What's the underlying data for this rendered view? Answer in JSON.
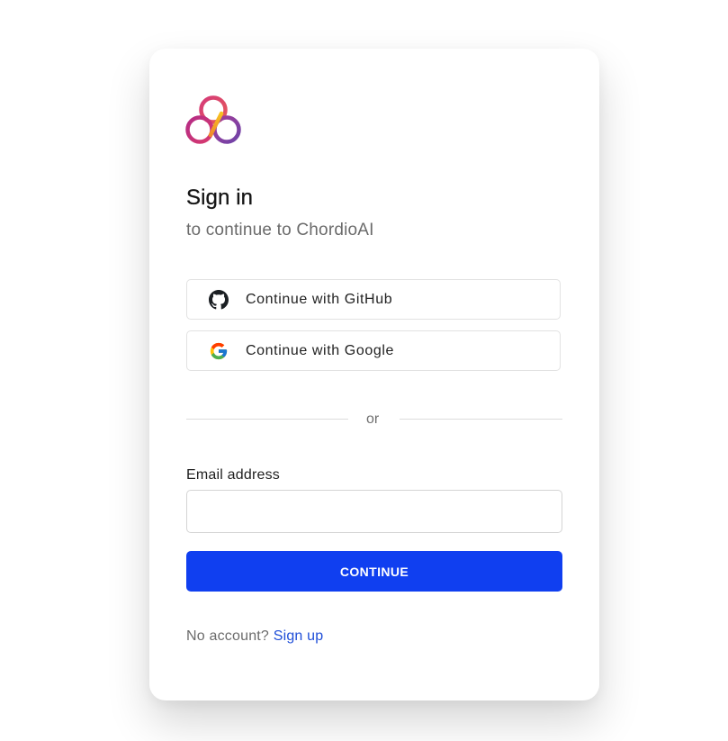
{
  "app": {
    "name": "ChordioAI"
  },
  "header": {
    "title": "Sign in",
    "subtitle": "to continue to ChordioAI"
  },
  "social": {
    "github_label": "Continue with GitHub",
    "google_label": "Continue with Google"
  },
  "divider": {
    "text": "or"
  },
  "email": {
    "label": "Email address",
    "value": "",
    "placeholder": ""
  },
  "continue_label": "CONTINUE",
  "footer": {
    "prompt": "No account?",
    "signup_link": "Sign up"
  },
  "colors": {
    "primary": "#103ff0",
    "link": "#1f4ed8",
    "logo_magenta": "#c2307e",
    "logo_orange": "#f3a51c",
    "logo_purple": "#7a3fa2"
  },
  "icons": {
    "logo": "chordio-logo-icon",
    "github": "github-icon",
    "google": "google-icon"
  }
}
